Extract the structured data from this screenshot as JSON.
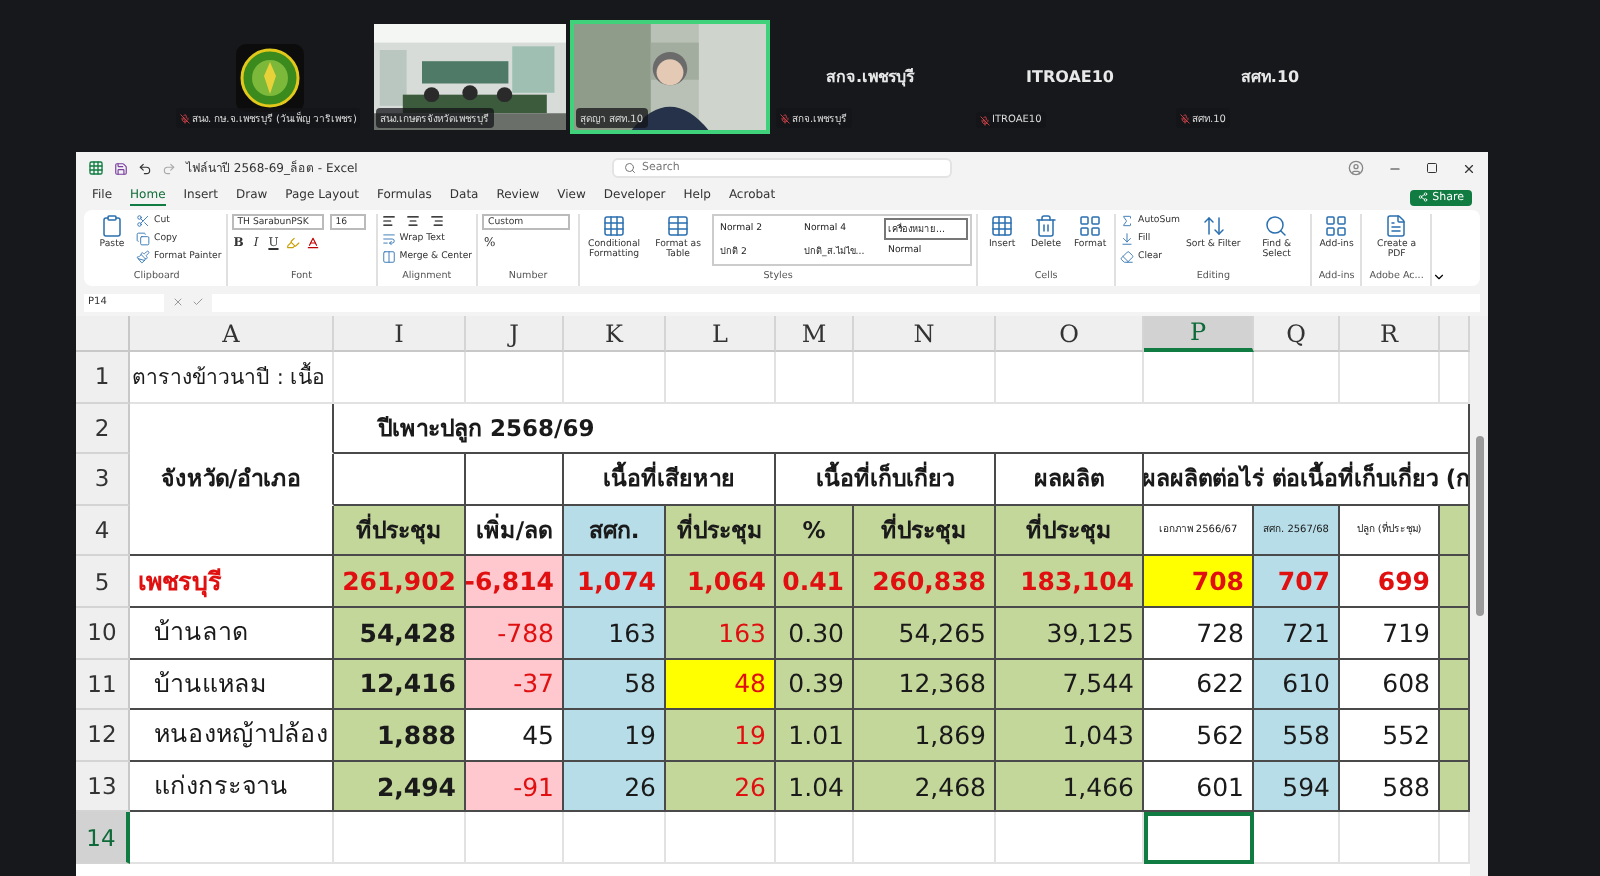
{
  "meeting": {
    "tiles": [
      {
        "kind": "logo",
        "label": "สนง. กษ.จ.เพชรบุรี (วันเพ็ญ วาริเพชร)",
        "muted": true,
        "selected": false
      },
      {
        "kind": "video",
        "label": "สนง.เกษตรจังหวัดเพชรบุรี",
        "muted": false,
        "selected": false
      },
      {
        "kind": "camera",
        "label": "สุดญา สศท.10",
        "muted": false,
        "selected": true
      },
      {
        "kind": "name",
        "name": "สกจ.เพชรบุรี",
        "label": "สกจ.เพชรบุรี",
        "muted": true,
        "selected": false
      },
      {
        "kind": "name",
        "name": "ITROAE10",
        "label": "ITROAE10",
        "muted": true,
        "selected": false
      },
      {
        "kind": "name",
        "name": "สศท.10",
        "label": "สศท.10",
        "muted": true,
        "selected": false
      }
    ]
  },
  "excel": {
    "title": "ไฟล์นาปี 2568-69_ล็อต - Excel",
    "search": {
      "placeholder": "Search"
    },
    "menu": [
      {
        "label": "File",
        "selected": false
      },
      {
        "label": "Home",
        "selected": true
      },
      {
        "label": "Insert",
        "selected": false
      },
      {
        "label": "Draw",
        "selected": false
      },
      {
        "label": "Page Layout",
        "selected": false
      },
      {
        "label": "Formulas",
        "selected": false
      },
      {
        "label": "Data",
        "selected": false
      },
      {
        "label": "Review",
        "selected": false
      },
      {
        "label": "View",
        "selected": false
      },
      {
        "label": "Developer",
        "selected": false
      },
      {
        "label": "Help",
        "selected": false
      },
      {
        "label": "Acrobat",
        "selected": false
      }
    ],
    "share": "Share",
    "ribbon": [
      {
        "label": "Clipboard",
        "items": [
          {
            "kind": "large",
            "label": "Paste"
          },
          {
            "kind": "small",
            "label": "Cut"
          },
          {
            "kind": "small",
            "label": "Copy"
          },
          {
            "kind": "small",
            "label": "Format Painter"
          }
        ]
      },
      {
        "label": "Font",
        "items": [
          {
            "kind": "combo",
            "label": "TH SarabunPSK"
          },
          {
            "kind": "combo",
            "label": "16"
          },
          {
            "kind": "glyph",
            "label": "B"
          },
          {
            "kind": "glyph",
            "label": "I"
          },
          {
            "kind": "glyph",
            "label": "U"
          }
        ]
      },
      {
        "label": "Alignment",
        "items": [
          {
            "kind": "small",
            "label": "Wrap Text"
          },
          {
            "kind": "small",
            "label": "Merge & Center"
          }
        ]
      },
      {
        "label": "Number",
        "items": [
          {
            "kind": "combo",
            "label": "Custom"
          },
          {
            "kind": "glyph",
            "label": "%"
          }
        ]
      },
      {
        "label": "Styles",
        "items": [
          {
            "kind": "large",
            "label": "Conditional Formatting"
          },
          {
            "kind": "large",
            "label": "Format as Table"
          },
          {
            "kind": "style",
            "label": "Normal 2",
            "selected": false
          },
          {
            "kind": "style",
            "label": "Normal 4",
            "selected": false
          },
          {
            "kind": "style",
            "label": "เครื่องหมาย...",
            "selected": true
          },
          {
            "kind": "style",
            "label": "ปกติ 2",
            "selected": false
          },
          {
            "kind": "style",
            "label": "ปกติ_ส.ไม่ไข...",
            "selected": false
          },
          {
            "kind": "style",
            "label": "Normal",
            "selected": false
          }
        ]
      },
      {
        "label": "Cells",
        "items": [
          {
            "kind": "large",
            "label": "Insert"
          },
          {
            "kind": "large",
            "label": "Delete"
          },
          {
            "kind": "large",
            "label": "Format"
          }
        ]
      },
      {
        "label": "Editing",
        "items": [
          {
            "kind": "small",
            "label": "AutoSum"
          },
          {
            "kind": "small",
            "label": "Fill"
          },
          {
            "kind": "small",
            "label": "Clear"
          },
          {
            "kind": "large",
            "label": "Sort & Filter"
          },
          {
            "kind": "large",
            "label": "Find & Select"
          }
        ]
      },
      {
        "label": "Add-ins",
        "items": [
          {
            "kind": "large",
            "label": "Add-ins"
          }
        ]
      },
      {
        "label": "Adobe Ac...",
        "items": [
          {
            "kind": "large",
            "label": "Create a PDF"
          }
        ]
      }
    ],
    "name_box": "P14",
    "sheet": {
      "columns": [
        {
          "label": "A",
          "selected": false
        },
        {
          "label": "I",
          "selected": false
        },
        {
          "label": "J",
          "selected": false
        },
        {
          "label": "K",
          "selected": false
        },
        {
          "label": "L",
          "selected": false
        },
        {
          "label": "M",
          "selected": false
        },
        {
          "label": "N",
          "selected": false
        },
        {
          "label": "O",
          "selected": false
        },
        {
          "label": "P",
          "selected": true
        },
        {
          "label": "Q",
          "selected": false
        },
        {
          "label": "R",
          "selected": false
        }
      ],
      "rows": [
        {
          "number": "1",
          "kind": "title",
          "selected": false,
          "cells": [
            {
              "kind": "title",
              "text": "ตารางข้าวนาปี : เนื้อ"
            }
          ]
        },
        {
          "number": "2",
          "kind": "header",
          "selected": false,
          "cells": [
            {
              "kind": "empty"
            },
            {
              "kind": "head",
              "text": "ปีเพาะปลูก 2568/69"
            }
          ]
        },
        {
          "number": "3",
          "kind": "header",
          "selected": false,
          "cells": [
            {
              "kind": "head",
              "text": "จังหวัด/อำเภอ"
            },
            {
              "kind": "empty"
            },
            {
              "kind": "empty"
            },
            {
              "kind": "head",
              "text": "เนื้อที่เสียหาย"
            },
            {
              "kind": "empty"
            },
            {
              "kind": "head",
              "text": "เนื้อที่เก็บเกี่ยว"
            },
            {
              "kind": "empty"
            },
            {
              "kind": "head",
              "text": "ผลผลิต"
            },
            {
              "kind": "head",
              "text": "ผลผลิตต่อไร่ ต่อเนื้อที่เก็บเกี่ยว (ก"
            }
          ]
        },
        {
          "number": "4",
          "kind": "header",
          "selected": false,
          "cells": [
            {
              "kind": "empty"
            },
            {
              "kind": "head",
              "text": "ที่ประชุม",
              "color": "#c4d79b"
            },
            {
              "kind": "head",
              "text": "เพิ่ม/ลด",
              "color": "#ffffff"
            },
            {
              "kind": "head",
              "text": "สศก.",
              "color": "#b7dde8"
            },
            {
              "kind": "head",
              "text": "ที่ประชุม",
              "color": "#c4d79b"
            },
            {
              "kind": "head",
              "text": "%",
              "color": "#c4d79b"
            },
            {
              "kind": "head",
              "text": "ที่ประชุม",
              "color": "#c4d79b"
            },
            {
              "kind": "head",
              "text": "ที่ประชุม",
              "color": "#c4d79b"
            },
            {
              "kind": "note",
              "text": "เอกภาพ 2566/67",
              "color": "#ffffff"
            },
            {
              "kind": "note",
              "text": "สศก. 2567/68",
              "color": "#b7dde8"
            },
            {
              "kind": "note",
              "text": "ปลูก (ที่ประชุม)",
              "color": "#ffffff"
            },
            {
              "kind": "empty",
              "color": "#c4d79b"
            }
          ]
        },
        {
          "number": "5",
          "kind": "data",
          "selected": false,
          "cells": [
            {
              "kind": "province",
              "text": "เพชรบุรี",
              "color": "#ffffff",
              "red": true,
              "bold": true
            },
            {
              "kind": "number",
              "text": "261,902",
              "color": "#c4d79b",
              "red": true,
              "bold": true
            },
            {
              "kind": "number",
              "text": "-6,814",
              "color": "#ffc7ce",
              "red": true,
              "bold": true
            },
            {
              "kind": "number",
              "text": "1,074",
              "color": "#b7dde8",
              "red": true,
              "bold": true
            },
            {
              "kind": "number",
              "text": "1,064",
              "color": "#c4d79b",
              "red": true,
              "bold": true
            },
            {
              "kind": "number",
              "text": "0.41",
              "color": "#c4d79b",
              "red": true,
              "bold": true
            },
            {
              "kind": "number",
              "text": "260,838",
              "color": "#c4d79b",
              "red": true,
              "bold": true
            },
            {
              "kind": "number",
              "text": "183,104",
              "color": "#c4d79b",
              "red": true,
              "bold": true
            },
            {
              "kind": "number",
              "text": "708",
              "color": "#ffff00",
              "red": true,
              "bold": true
            },
            {
              "kind": "number",
              "text": "707",
              "color": "#b7dde8",
              "red": true,
              "bold": true
            },
            {
              "kind": "number",
              "text": "699",
              "color": "#ffffff",
              "red": true,
              "bold": true
            },
            {
              "kind": "empty",
              "color": "#c4d79b"
            }
          ]
        },
        {
          "number": "10",
          "kind": "data",
          "selected": false,
          "cells": [
            {
              "kind": "district",
              "text": "บ้านลาด",
              "color": "#ffffff",
              "red": false,
              "bold": false
            },
            {
              "kind": "number",
              "text": "54,428",
              "color": "#c4d79b",
              "red": false,
              "bold": true
            },
            {
              "kind": "number",
              "text": "-788",
              "color": "#ffc7ce",
              "red": true,
              "bold": false
            },
            {
              "kind": "number",
              "text": "163",
              "color": "#b7dde8",
              "red": false,
              "bold": false
            },
            {
              "kind": "number",
              "text": "163",
              "color": "#c4d79b",
              "red": true,
              "bold": false
            },
            {
              "kind": "number",
              "text": "0.30",
              "color": "#c4d79b",
              "red": false,
              "bold": false
            },
            {
              "kind": "number",
              "text": "54,265",
              "color": "#c4d79b",
              "red": false,
              "bold": false
            },
            {
              "kind": "number",
              "text": "39,125",
              "color": "#c4d79b",
              "red": false,
              "bold": false
            },
            {
              "kind": "number",
              "text": "728",
              "color": "#ffffff",
              "red": false,
              "bold": false
            },
            {
              "kind": "number",
              "text": "721",
              "color": "#b7dde8",
              "red": false,
              "bold": false
            },
            {
              "kind": "number",
              "text": "719",
              "color": "#ffffff",
              "red": false,
              "bold": false
            },
            {
              "kind": "empty",
              "color": "#c4d79b"
            }
          ]
        },
        {
          "number": "11",
          "kind": "data",
          "selected": false,
          "cells": [
            {
              "kind": "district",
              "text": "บ้านแหลม",
              "color": "#ffffff",
              "red": false,
              "bold": false
            },
            {
              "kind": "number",
              "text": "12,416",
              "color": "#c4d79b",
              "red": false,
              "bold": true
            },
            {
              "kind": "number",
              "text": "-37",
              "color": "#ffc7ce",
              "red": true,
              "bold": false
            },
            {
              "kind": "number",
              "text": "58",
              "color": "#b7dde8",
              "red": false,
              "bold": false
            },
            {
              "kind": "number",
              "text": "48",
              "color": "#ffff00",
              "red": true,
              "bold": false
            },
            {
              "kind": "number",
              "text": "0.39",
              "color": "#c4d79b",
              "red": false,
              "bold": false
            },
            {
              "kind": "number",
              "text": "12,368",
              "color": "#c4d79b",
              "red": false,
              "bold": false
            },
            {
              "kind": "number",
              "text": "7,544",
              "color": "#c4d79b",
              "red": false,
              "bold": false
            },
            {
              "kind": "number",
              "text": "622",
              "color": "#ffffff",
              "red": false,
              "bold": false
            },
            {
              "kind": "number",
              "text": "610",
              "color": "#b7dde8",
              "red": false,
              "bold": false
            },
            {
              "kind": "number",
              "text": "608",
              "color": "#ffffff",
              "red": false,
              "bold": false
            },
            {
              "kind": "empty",
              "color": "#c4d79b"
            }
          ]
        },
        {
          "number": "12",
          "kind": "data",
          "selected": false,
          "cells": [
            {
              "kind": "district",
              "text": "หนองหญ้าปล้อง",
              "color": "#ffffff",
              "red": false,
              "bold": false
            },
            {
              "kind": "number",
              "text": "1,888",
              "color": "#c4d79b",
              "red": false,
              "bold": true
            },
            {
              "kind": "number",
              "text": "45",
              "color": "#ffffff",
              "red": false,
              "bold": false
            },
            {
              "kind": "number",
              "text": "19",
              "color": "#b7dde8",
              "red": false,
              "bold": false
            },
            {
              "kind": "number",
              "text": "19",
              "color": "#c4d79b",
              "red": true,
              "bold": false
            },
            {
              "kind": "number",
              "text": "1.01",
              "color": "#c4d79b",
              "red": false,
              "bold": false
            },
            {
              "kind": "number",
              "text": "1,869",
              "color": "#c4d79b",
              "red": false,
              "bold": false
            },
            {
              "kind": "number",
              "text": "1,043",
              "color": "#c4d79b",
              "red": false,
              "bold": false
            },
            {
              "kind": "number",
              "text": "562",
              "color": "#ffffff",
              "red": false,
              "bold": false
            },
            {
              "kind": "number",
              "text": "558",
              "color": "#b7dde8",
              "red": false,
              "bold": false
            },
            {
              "kind": "number",
              "text": "552",
              "color": "#ffffff",
              "red": false,
              "bold": false
            },
            {
              "kind": "empty",
              "color": "#c4d79b"
            }
          ]
        },
        {
          "number": "13",
          "kind": "data",
          "selected": false,
          "cells": [
            {
              "kind": "district",
              "text": "แก่งกระจาน",
              "color": "#ffffff",
              "red": false,
              "bold": false
            },
            {
              "kind": "number",
              "text": "2,494",
              "color": "#c4d79b",
              "red": false,
              "bold": true
            },
            {
              "kind": "number",
              "text": "-91",
              "color": "#ffc7ce",
              "red": true,
              "bold": false
            },
            {
              "kind": "number",
              "text": "26",
              "color": "#b7dde8",
              "red": false,
              "bold": false
            },
            {
              "kind": "number",
              "text": "26",
              "color": "#c4d79b",
              "red": true,
              "bold": false
            },
            {
              "kind": "number",
              "text": "1.04",
              "color": "#c4d79b",
              "red": false,
              "bold": false
            },
            {
              "kind": "number",
              "text": "2,468",
              "color": "#c4d79b",
              "red": false,
              "bold": false
            },
            {
              "kind": "number",
              "text": "1,466",
              "color": "#c4d79b",
              "red": false,
              "bold": false
            },
            {
              "kind": "number",
              "text": "601",
              "color": "#ffffff",
              "red": false,
              "bold": false
            },
            {
              "kind": "number",
              "text": "594",
              "color": "#b7dde8",
              "red": false,
              "bold": false
            },
            {
              "kind": "number",
              "text": "588",
              "color": "#ffffff",
              "red": false,
              "bold": false
            },
            {
              "kind": "empty",
              "color": "#c4d79b"
            }
          ]
        },
        {
          "number": "14",
          "kind": "data",
          "selected": true,
          "cells": []
        }
      ]
    }
  }
}
